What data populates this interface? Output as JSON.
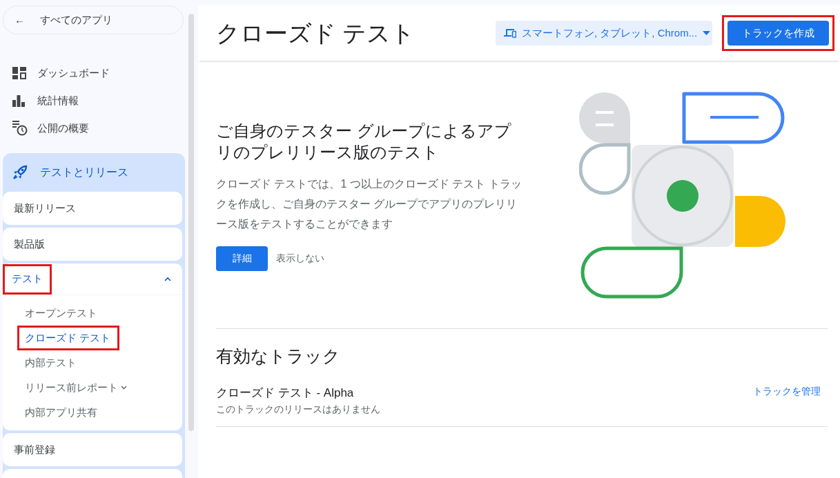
{
  "sidebar": {
    "back_button": {
      "icon": "←",
      "label": "すべてのアプリ"
    },
    "nav_items": [
      {
        "label": "ダッシュボード",
        "kind": "dashboard"
      },
      {
        "label": "統計情報",
        "kind": "stats"
      },
      {
        "label": "公開の概要",
        "kind": "overview"
      }
    ],
    "section": {
      "label": "テストとリリース",
      "items": [
        {
          "label": "最新リリース",
          "selected": false,
          "highlighted": false,
          "expanded": false
        },
        {
          "label": "製品版",
          "selected": false,
          "highlighted": false,
          "expanded": false
        },
        {
          "label": "テスト",
          "selected": true,
          "highlighted": true,
          "expanded": true,
          "children": [
            {
              "label": "オープンテスト",
              "selected": false,
              "highlighted": false,
              "expandable": false
            },
            {
              "label": "クローズド テスト",
              "selected": true,
              "highlighted": true,
              "expandable": false
            },
            {
              "label": "内部テスト",
              "selected": false,
              "highlighted": false,
              "expandable": false
            },
            {
              "label": "リリース前レポート",
              "selected": false,
              "highlighted": false,
              "expandable": true
            },
            {
              "label": "内部アプリ共有",
              "selected": false,
              "highlighted": false,
              "expandable": false
            }
          ]
        },
        {
          "label": "事前登録",
          "selected": false,
          "highlighted": false,
          "expanded": false
        }
      ]
    }
  },
  "header": {
    "title": "クローズド テスト",
    "device_select": {
      "value": "スマートフォン, タブレット, Chrom..."
    },
    "create_button": {
      "label": "トラックを作成",
      "highlighted": true
    }
  },
  "promo": {
    "heading": "ご自身のテスター グループによるアプリのプレリリース版のテスト",
    "body": "クローズド テストでは、1 つ以上のクローズド テスト トラックを作成し、ご自身のテスター グループでアプリのプレリリース版をテストすることができます",
    "primary_button": "詳細",
    "secondary_button": "表示しない"
  },
  "tracks": {
    "heading": "有効なトラック",
    "items": [
      {
        "name": "クローズド テスト - Alpha",
        "status": "このトラックのリリースはありません",
        "action": "トラックを管理"
      }
    ]
  }
}
